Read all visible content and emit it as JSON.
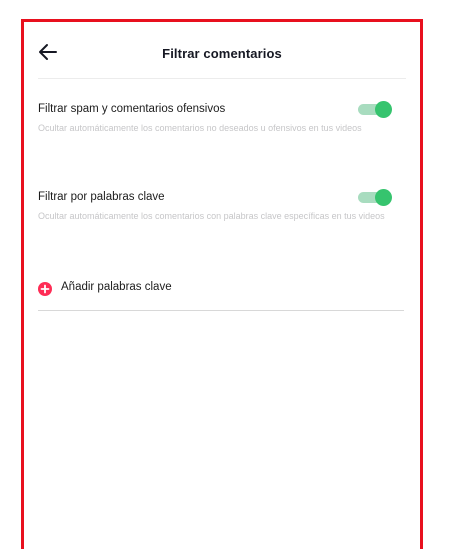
{
  "header": {
    "title": "Filtrar comentarios",
    "back_icon": "arrow-left-icon"
  },
  "settings": [
    {
      "label": "Filtrar spam y comentarios ofensivos",
      "description": "Ocultar automáticamente los comentarios no deseados u ofensivos en tus videos",
      "enabled": true
    },
    {
      "label": "Filtrar por palabras clave",
      "description": "Ocultar automáticamente los comentarios con palabras clave específicas en tus videos",
      "enabled": true
    }
  ],
  "add_keywords": {
    "label": "Añadir palabras clave",
    "icon": "plus-circle-icon"
  },
  "colors": {
    "frame_border": "#e8101e",
    "toggle_on": "#36c46e",
    "toggle_track": "#a8dcbf",
    "add_icon": "#fe2c55",
    "description_text": "#c6c6c8"
  }
}
